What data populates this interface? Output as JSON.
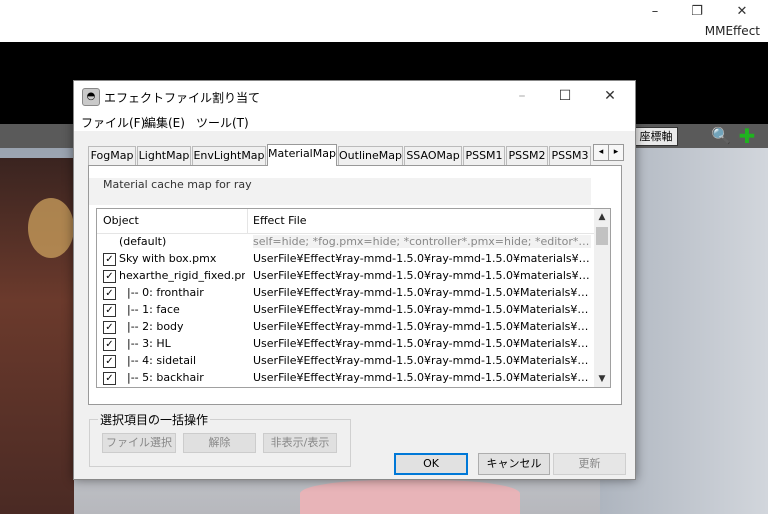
{
  "app": {
    "title": "MMEffect",
    "controls": {
      "minimize": "–",
      "restore": "❐",
      "close": "✕"
    }
  },
  "toolbar": {
    "coordinate_button": "座標軸",
    "zoom_icon": "magnifier-icon",
    "move_icon": "move-cross-icon"
  },
  "dialog": {
    "title": "エフェクトファイル割り当て",
    "controls": {
      "minimize": "–",
      "maximize": "☐",
      "close": "✕"
    },
    "menu": [
      "ファイル(F)",
      "編集(E)",
      "ツール(T)"
    ],
    "tabs": [
      "FogMap",
      "LightMap",
      "EnvLightMap",
      "MaterialMap",
      "OutlineMap",
      "SSAOMap",
      "PSSM1",
      "PSSM2",
      "PSSM3"
    ],
    "active_tab": "MaterialMap",
    "tab_scroll": {
      "left": "◂",
      "right": "▸"
    },
    "description": "Material cache map for ray",
    "list": {
      "headers": {
        "object": "Object",
        "effect": "Effect File"
      },
      "scroll": {
        "up": "▲",
        "down": "▼"
      },
      "rows": [
        {
          "object": "(default)",
          "effect": "self=hide; *fog.pmx=hide; *controller*.pmx=hide; *editor*.pmx=...",
          "checked": null
        },
        {
          "object": "Sky with box.pmx",
          "effect": "UserFile¥Effect¥ray-mmd-1.5.0¥ray-mmd-1.5.0¥materials¥materia...",
          "checked": "✓"
        },
        {
          "object": "hexarthe_rigid_fixed.pmx",
          "effect": "UserFile¥Effect¥ray-mmd-1.5.0¥ray-mmd-1.5.0¥materials¥materia...",
          "checked": "✓"
        },
        {
          "object": "|-- 0: fronthair",
          "effect": "UserFile¥Effect¥ray-mmd-1.5.0¥ray-mmd-1.5.0¥Materials¥Toon_R...",
          "checked": "✓"
        },
        {
          "object": "|-- 1: face",
          "effect": "UserFile¥Effect¥ray-mmd-1.5.0¥ray-mmd-1.5.0¥Materials¥Toon_R...",
          "checked": "✓"
        },
        {
          "object": "|-- 2: body",
          "effect": "UserFile¥Effect¥ray-mmd-1.5.0¥ray-mmd-1.5.0¥Materials¥Toon_R...",
          "checked": "✓"
        },
        {
          "object": "|-- 3: HL",
          "effect": "UserFile¥Effect¥ray-mmd-1.5.0¥ray-mmd-1.5.0¥Materials¥Emissiv...",
          "checked": "✓"
        },
        {
          "object": "|-- 4: sidetail",
          "effect": "UserFile¥Effect¥ray-mmd-1.5.0¥ray-mmd-1.5.0¥Materials¥Toon_R...",
          "checked": "✓"
        },
        {
          "object": "|-- 5: backhair",
          "effect": "UserFile¥Effect¥ray-mmd-1.5.0¥ray-mmd-1.5.0¥Materials¥Toon_R...",
          "checked": "✓"
        }
      ]
    },
    "bulk": {
      "label": "選択項目の一括操作",
      "select_file": "ファイル選択",
      "remove": "解除",
      "toggle_visibility": "非表示/表示"
    },
    "buttons": {
      "ok": "OK",
      "cancel": "キャンセル",
      "update": "更新"
    }
  },
  "colors": {
    "accent": "#0078d7",
    "toolbar": "#5a5a5a"
  }
}
